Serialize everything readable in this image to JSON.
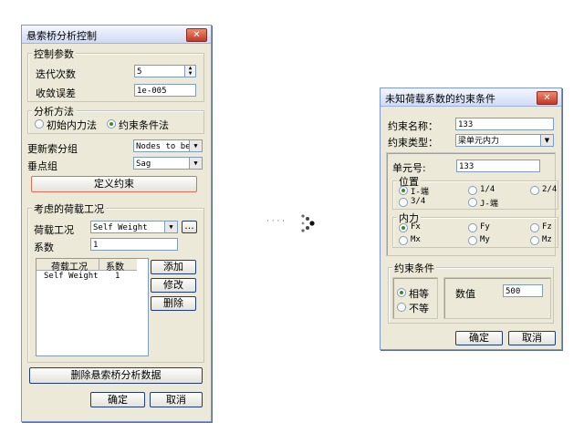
{
  "left": {
    "title": "悬索桥分析控制",
    "close_label": "✕",
    "control": {
      "legend": "控制参数",
      "iter_label": "迭代次数",
      "iter_value": "5",
      "tol_label": "收敛误差",
      "tol_value": "1e-005"
    },
    "method": {
      "legend": "分析方法",
      "option1": "初始内力法",
      "option2": "约束条件法",
      "selected": "约束条件法"
    },
    "update_group_label": "更新索分组",
    "update_group_value": "Nodes to be",
    "sag_group_label": "垂点组",
    "sag_group_value": "Sag",
    "define_button": "定义约束",
    "loads": {
      "legend": "考虑的荷载工况",
      "case_label": "荷载工况",
      "case_value": "Self Weight",
      "more_label": "...",
      "factor_label": "系数",
      "factor_value": "1",
      "columns": [
        "荷载工况",
        "系数"
      ],
      "rows": [
        {
          "case": "Self Weight",
          "factor": "1"
        }
      ],
      "add_button": "添加",
      "edit_button": "修改",
      "delete_button": "删除"
    },
    "delete_data_button": "删除悬索桥分析数据",
    "ok_button": "确定",
    "cancel_button": "取消"
  },
  "arrow_text": "· · · ·",
  "right": {
    "title": "未知荷载系数的约束条件",
    "close_label": "✕",
    "name_label": "约束名称：",
    "name_value": "133",
    "type_label": "约束类型：",
    "type_value": "梁单元内力",
    "element_label": "单元号:",
    "element_value": "133",
    "position": {
      "legend": "位置",
      "options": [
        "I-端",
        "1/4",
        "2/4",
        "3/4",
        "J-端"
      ],
      "selected": "I-端"
    },
    "force": {
      "legend": "内力",
      "options": [
        "Fx",
        "Fy",
        "Fz",
        "Mx",
        "My",
        "Mz"
      ],
      "selected": "Fx"
    },
    "condition": {
      "legend": "约束条件",
      "equal": "相等",
      "not_equal": "不等",
      "selected": "相等",
      "value_label": "数值",
      "value": "500"
    },
    "ok_button": "确定",
    "cancel_button": "取消"
  }
}
